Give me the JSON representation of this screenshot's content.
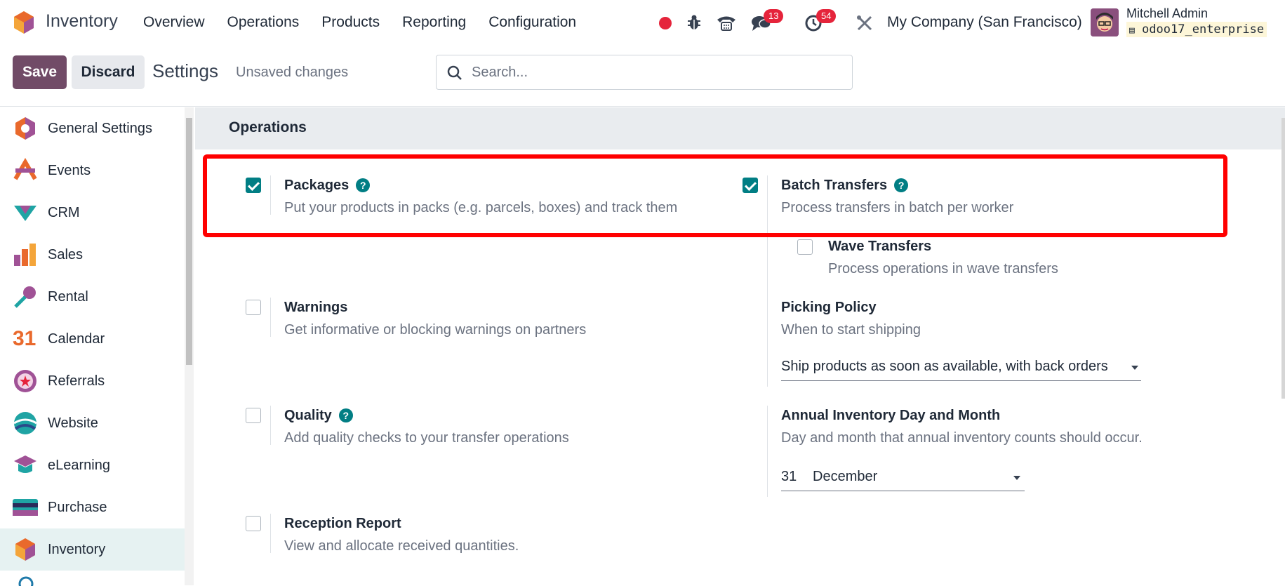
{
  "app": {
    "name": "Inventory"
  },
  "menu": [
    "Overview",
    "Operations",
    "Products",
    "Reporting",
    "Configuration"
  ],
  "systray": {
    "messages_badge": "13",
    "activities_badge": "54",
    "company": "My Company (San Francisco)",
    "user_name": "Mitchell Admin",
    "database": "odoo17_enterprise"
  },
  "control": {
    "save_label": "Save",
    "discard_label": "Discard",
    "title": "Settings",
    "status": "Unsaved changes",
    "search_placeholder": "Search..."
  },
  "sidebar": {
    "items": [
      {
        "label": "General Settings"
      },
      {
        "label": "Events"
      },
      {
        "label": "CRM"
      },
      {
        "label": "Sales"
      },
      {
        "label": "Rental"
      },
      {
        "label": "Calendar"
      },
      {
        "label": "Referrals"
      },
      {
        "label": "Website"
      },
      {
        "label": "eLearning"
      },
      {
        "label": "Purchase"
      },
      {
        "label": "Inventory"
      }
    ],
    "calendar_icon_text": "31"
  },
  "section": {
    "title": "Operations"
  },
  "settings": {
    "packages": {
      "title": "Packages",
      "desc": "Put your products in packs (e.g. parcels, boxes) and track them",
      "checked": true
    },
    "batch": {
      "title": "Batch Transfers",
      "desc": "Process transfers in batch per worker",
      "checked": true
    },
    "wave": {
      "title": "Wave Transfers",
      "desc": "Process operations in wave transfers",
      "checked": false
    },
    "warnings": {
      "title": "Warnings",
      "desc": "Get informative or blocking warnings on partners",
      "checked": false
    },
    "picking": {
      "title": "Picking Policy",
      "desc": "When to start shipping",
      "value": "Ship products as soon as available, with back orders"
    },
    "quality": {
      "title": "Quality",
      "desc": "Add quality checks to your transfer operations",
      "checked": false
    },
    "annual": {
      "title": "Annual Inventory Day and Month",
      "desc": "Day and month that annual inventory counts should occur.",
      "day": "31",
      "month": "December"
    },
    "reception": {
      "title": "Reception Report",
      "desc": "View and allocate received quantities.",
      "checked": false
    }
  },
  "help_glyph": "?",
  "colors": {
    "primary": "#714b67",
    "accent": "#017e84",
    "highlight": "#ff0000",
    "badge": "#e5243b"
  }
}
